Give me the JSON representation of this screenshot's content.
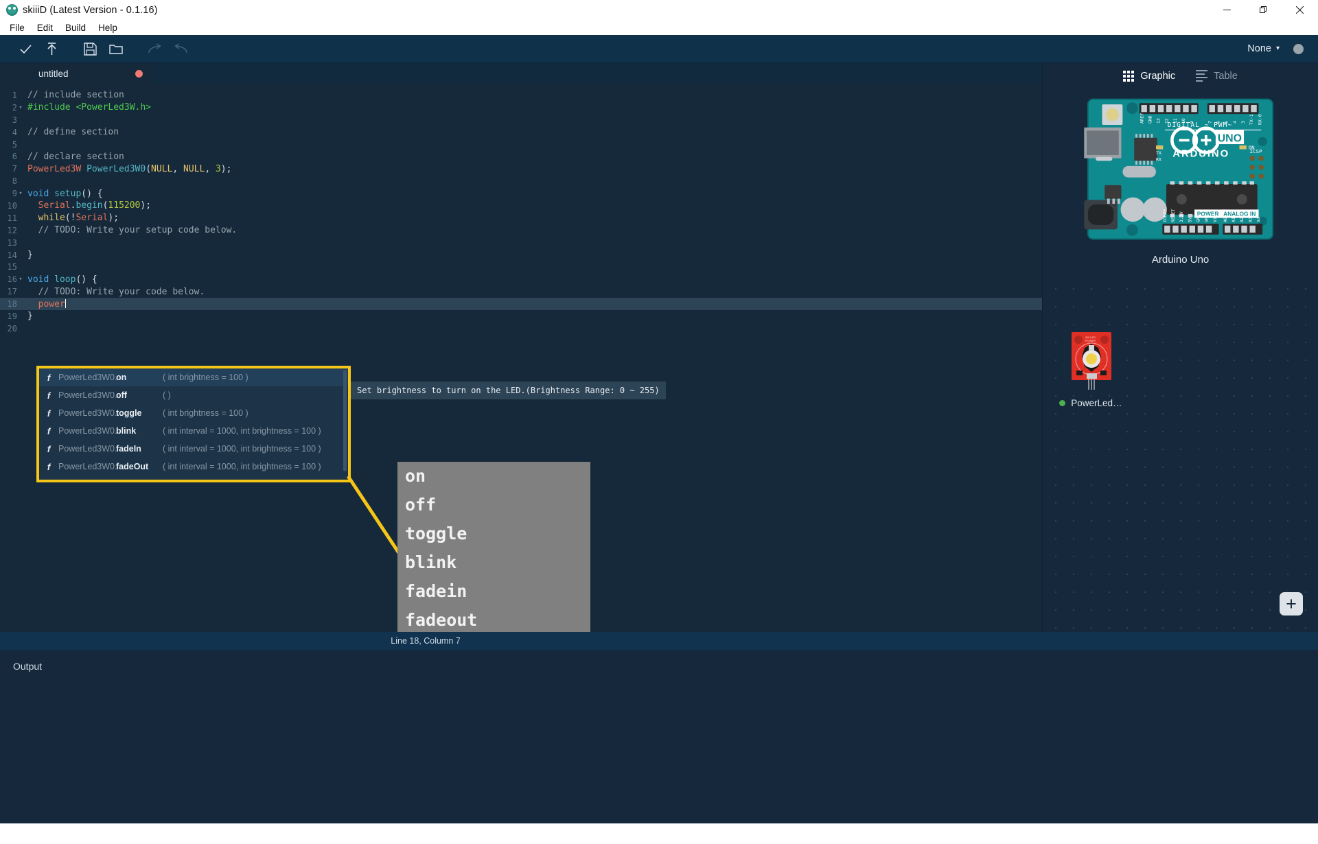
{
  "window": {
    "title": "skiiiD (Latest Version - 0.1.16)",
    "controls": {
      "minimize": "minimize-icon",
      "restore": "restore-icon",
      "close": "close-icon"
    }
  },
  "menubar": {
    "items": [
      "File",
      "Edit",
      "Build",
      "Help"
    ]
  },
  "toolbar": {
    "buttons": [
      {
        "name": "verify-button",
        "icon": "check-icon"
      },
      {
        "name": "upload-button",
        "icon": "upload-arrow-icon"
      },
      {
        "name": "save-button",
        "icon": "floppy-disk-icon"
      },
      {
        "name": "open-button",
        "icon": "folder-icon"
      },
      {
        "name": "redo-button",
        "icon": "redo-icon"
      },
      {
        "name": "undo-button",
        "icon": "undo-icon"
      }
    ],
    "board_select": {
      "value": "None",
      "caret": "▾"
    },
    "status_dot_color": "#9aa4ab"
  },
  "tabs": [
    {
      "label": "untitled",
      "modified": true,
      "dot_color": "#f07b72"
    }
  ],
  "editor": {
    "lines": [
      {
        "n": "1",
        "fold": "",
        "segments": [
          {
            "t": "// include section",
            "c": "cm"
          }
        ]
      },
      {
        "n": "2",
        "fold": "▾",
        "segments": [
          {
            "t": "#include <PowerLed3W.h>",
            "c": "pp"
          }
        ]
      },
      {
        "n": "3",
        "fold": "",
        "segments": []
      },
      {
        "n": "4",
        "fold": "",
        "segments": [
          {
            "t": "// define section",
            "c": "cm"
          }
        ]
      },
      {
        "n": "5",
        "fold": "",
        "segments": []
      },
      {
        "n": "6",
        "fold": "",
        "segments": [
          {
            "t": "// declare section",
            "c": "cm"
          }
        ]
      },
      {
        "n": "7",
        "fold": "",
        "segments": [
          {
            "t": "PowerLed3W",
            "c": "type"
          },
          {
            "t": " ",
            "c": "id"
          },
          {
            "t": "PowerLed3W0",
            "c": "fn"
          },
          {
            "t": "(",
            "c": "id"
          },
          {
            "t": "NULL",
            "c": "kw"
          },
          {
            "t": ", ",
            "c": "id"
          },
          {
            "t": "NULL",
            "c": "kw"
          },
          {
            "t": ", ",
            "c": "id"
          },
          {
            "t": "3",
            "c": "num"
          },
          {
            "t": ");",
            "c": "id"
          }
        ]
      },
      {
        "n": "8",
        "fold": "",
        "segments": []
      },
      {
        "n": "9",
        "fold": "▾",
        "segments": [
          {
            "t": "void",
            "c": "kw2"
          },
          {
            "t": " ",
            "c": "id"
          },
          {
            "t": "setup",
            "c": "fn"
          },
          {
            "t": "() {",
            "c": "id"
          }
        ]
      },
      {
        "n": "10",
        "fold": "",
        "segments": [
          {
            "t": "  ",
            "c": "id"
          },
          {
            "t": "Serial",
            "c": "var"
          },
          {
            "t": ".",
            "c": "id"
          },
          {
            "t": "begin",
            "c": "fn"
          },
          {
            "t": "(",
            "c": "id"
          },
          {
            "t": "115200",
            "c": "num"
          },
          {
            "t": ");",
            "c": "id"
          }
        ]
      },
      {
        "n": "11",
        "fold": "",
        "segments": [
          {
            "t": "  ",
            "c": "id"
          },
          {
            "t": "while",
            "c": "kw"
          },
          {
            "t": "(!",
            "c": "id"
          },
          {
            "t": "Serial",
            "c": "var"
          },
          {
            "t": ");",
            "c": "id"
          }
        ]
      },
      {
        "n": "12",
        "fold": "",
        "segments": [
          {
            "t": "  // TODO: Write your setup code below.",
            "c": "cm"
          }
        ]
      },
      {
        "n": "13",
        "fold": "",
        "segments": []
      },
      {
        "n": "14",
        "fold": "",
        "segments": [
          {
            "t": "}",
            "c": "id"
          }
        ]
      },
      {
        "n": "15",
        "fold": "",
        "segments": []
      },
      {
        "n": "16",
        "fold": "▾",
        "segments": [
          {
            "t": "void",
            "c": "kw2"
          },
          {
            "t": " ",
            "c": "id"
          },
          {
            "t": "loop",
            "c": "fn"
          },
          {
            "t": "() {",
            "c": "id"
          }
        ]
      },
      {
        "n": "17",
        "fold": "",
        "segments": [
          {
            "t": "  // TODO: Write your code below.",
            "c": "cm"
          }
        ]
      },
      {
        "n": "18",
        "fold": "",
        "current": true,
        "segments": [
          {
            "t": "  ",
            "c": "id"
          },
          {
            "t": "power",
            "c": "type"
          }
        ]
      },
      {
        "n": "19",
        "fold": "",
        "segments": [
          {
            "t": "}",
            "c": "id"
          }
        ]
      },
      {
        "n": "20",
        "fold": "",
        "segments": []
      }
    ]
  },
  "autocomplete": {
    "items": [
      {
        "kind": "f",
        "object": "PowerLed3W0.",
        "name": "on",
        "signature": "( int brightness = 100 )",
        "selected": true
      },
      {
        "kind": "f",
        "object": "PowerLed3W0.",
        "name": "off",
        "signature": "( )",
        "selected": false
      },
      {
        "kind": "f",
        "object": "PowerLed3W0.",
        "name": "toggle",
        "signature": "( int brightness = 100 )",
        "selected": false
      },
      {
        "kind": "f",
        "object": "PowerLed3W0.",
        "name": "blink",
        "signature": "( int interval = 1000, int brightness = 100 )",
        "selected": false
      },
      {
        "kind": "f",
        "object": "PowerLed3W0.",
        "name": "fadeIn",
        "signature": "( int interval = 1000, int brightness = 100 )",
        "selected": false
      },
      {
        "kind": "f",
        "object": "PowerLed3W0.",
        "name": "fadeOut",
        "signature": "( int interval = 1000, int brightness = 100 )",
        "selected": false
      }
    ],
    "highlight_color": "#f5c518"
  },
  "tooltip": {
    "text": "Set brightness to turn on the LED.(Brightness Range: 0 ~ 255)"
  },
  "callout": {
    "items": [
      "on",
      "off",
      "toggle",
      "blink",
      "fadein",
      "fadeout"
    ],
    "background": "#808080",
    "leader_color": "#f5c518"
  },
  "right_panel": {
    "tabs": [
      {
        "label": "Graphic",
        "icon": "grid-icon",
        "active": true
      },
      {
        "label": "Table",
        "icon": "list-icon",
        "active": false
      }
    ],
    "board": {
      "name": "Arduino Uno",
      "silk_uno": "UNO",
      "silk_brand": "ARDUINO",
      "silk_digital": "DIGITAL  ~  PWM~",
      "silk_power": "POWER",
      "silk_analog": "ANALOG IN"
    },
    "component": {
      "label": "PowerLed…",
      "status_color": "#4caf50",
      "silk": "3W LED POWER"
    },
    "add_button": {
      "label": "+"
    }
  },
  "statusbar": {
    "text": "Line 18, Column 7"
  },
  "output": {
    "title": "Output"
  }
}
